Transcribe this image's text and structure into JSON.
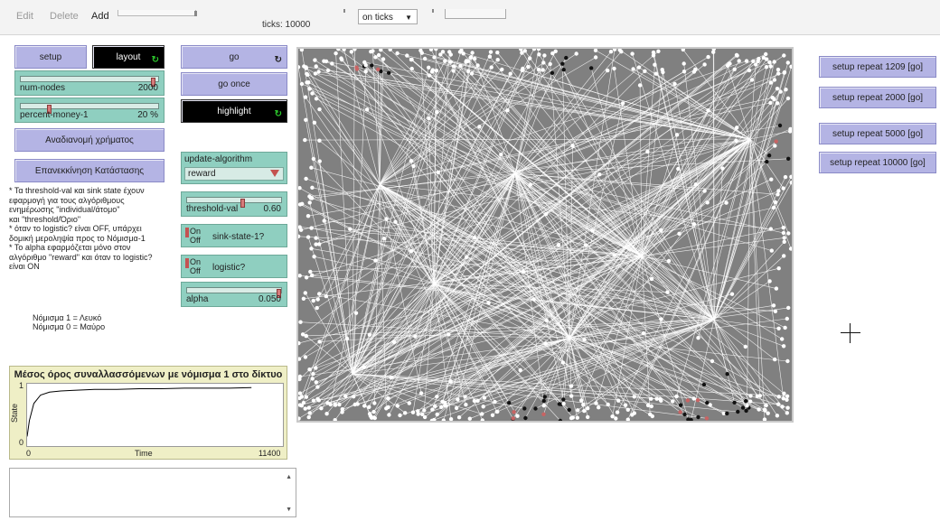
{
  "toolbar": {
    "edit": "Edit",
    "delete": "Delete",
    "add": "Add",
    "ticks": "ticks: 10000",
    "update_mode": "on ticks"
  },
  "controls": {
    "setup": "setup",
    "layout": "layout",
    "go": "go",
    "go_once": "go once",
    "highlight": "highlight",
    "redistribute": "Αναδιανομή χρήματος",
    "reset_state": "Επανεκκίνηση Κατάστασης",
    "num_nodes": {
      "name": "num-nodes",
      "value": "2000",
      "fraction": 0.98
    },
    "percent_money": {
      "name": "percent-money-1",
      "value": "20 %",
      "fraction": 0.2
    },
    "update_algorithm": {
      "label": "update-algorithm",
      "value": "reward"
    },
    "threshold_val": {
      "name": "threshold-val",
      "value": "0.60",
      "fraction": 0.6
    },
    "sink_state": {
      "on": "On",
      "off": "Off",
      "label": "sink-state-1?"
    },
    "logistic": {
      "on": "On",
      "off": "Off",
      "label": "logistic?"
    },
    "alpha": {
      "name": "alpha",
      "value": "0.050",
      "fraction": 1.0
    }
  },
  "notes": {
    "info": "* Τα threshold-val και sink state έχουν\nεφαρμογή για τους  αλγόριθμους\nενημέρωσης \"individual/άτομο\"\nκαι \"threshold/Όριο\"\n* όταν το logistic? είναι OFF, υπάρχει\nδομική μεροληψία προς το Νόμισμα-1\n* Το alpha εφαρμόζεται μόνο στον\nαλγόριθμο \"reward\" και όταν το logistic?\nείναι ON",
    "legend_line1": "Νόμισμα 1 = Λευκό",
    "legend_line2": "Νόμισμα 0 = Μαύρο"
  },
  "plot": {
    "title": "Μέσος όρος συναλλασσόμενων με νόμισμα 1 στο δίκτυο",
    "ylabel": "State",
    "xlabel": "Time",
    "y_max": "1",
    "y_min": "0",
    "x_min": "0",
    "x_max": "11400"
  },
  "chart_data": {
    "type": "line",
    "title": "Μέσος όρος συναλλασσόμενων με νόμισμα 1 στο δίκτυο",
    "xlabel": "Time",
    "ylabel": "State",
    "xlim": [
      0,
      11400
    ],
    "ylim": [
      0,
      1
    ],
    "x": [
      0,
      100,
      300,
      600,
      1000,
      1500,
      2000,
      3000,
      4000,
      5000,
      6000,
      7000,
      8000,
      9000,
      10000
    ],
    "y": [
      0.12,
      0.4,
      0.7,
      0.85,
      0.9,
      0.92,
      0.93,
      0.95,
      0.95,
      0.96,
      0.96,
      0.97,
      0.97,
      0.97,
      0.98
    ]
  },
  "repeat_buttons": [
    "setup repeat 1209 [go]",
    "setup repeat 2000 [go]",
    "setup repeat 5000 [go]",
    "setup repeat 10000 [go]"
  ],
  "colors": {
    "button": "#b4b4e4",
    "slider": "#8fcfc0",
    "plot_bg": "#efefc6",
    "view_bg": "#808080"
  }
}
